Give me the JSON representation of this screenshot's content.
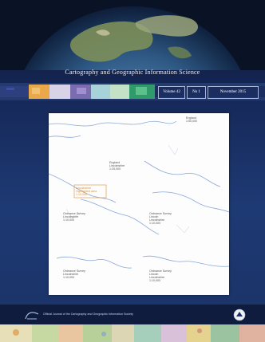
{
  "journal": {
    "title": "Cartography and Geographic Information Science",
    "volume": "Volume 42",
    "number": "No 1",
    "date": "November 2015"
  },
  "map_panel": {
    "labels": [
      {
        "name": "top-right-label",
        "lines": [
          "England",
          "1:50,000"
        ]
      },
      {
        "name": "center-label",
        "lines": [
          "England",
          "Lincolnshire",
          "1:25,000"
        ]
      },
      {
        "name": "orange-label",
        "lines": [
          "Lincolnshire",
          "Highlighted area",
          "1:10,000"
        ]
      },
      {
        "name": "middle-left-label",
        "lines": [
          "Ordnance Survey",
          "Lincolnshire",
          "1:10,000"
        ]
      },
      {
        "name": "middle-right-label",
        "lines": [
          "Ordnance Survey",
          "Lincoln",
          "Lincolnshire",
          "1:10,000"
        ]
      },
      {
        "name": "bottom-left-label",
        "lines": [
          "Ordnance Survey",
          "Lincolnshire",
          "1:10,000"
        ]
      },
      {
        "name": "bottom-right-label",
        "lines": [
          "Ordnance Survey",
          "Lincoln",
          "Lincolnshire",
          "1:10,000"
        ]
      }
    ]
  },
  "footer": {
    "publisher_text": "Official Journal of the Cartography and Geographic Information Society"
  },
  "colors": {
    "background": "#1a3266",
    "accent_orange": "#e08a2a",
    "map_line": "#8aa8d8"
  }
}
